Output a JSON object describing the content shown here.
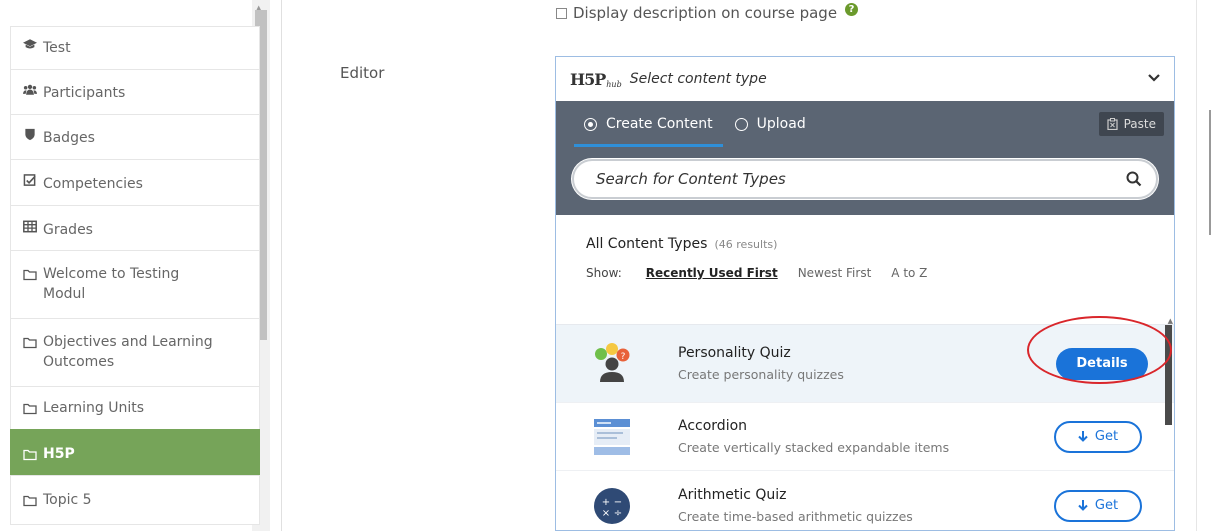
{
  "sidebar": {
    "items": [
      {
        "label": "Test",
        "icon": "graduation-cap-icon"
      },
      {
        "label": "Participants",
        "icon": "users-icon"
      },
      {
        "label": "Badges",
        "icon": "shield-icon"
      },
      {
        "label": "Competencies",
        "icon": "check-square-icon"
      },
      {
        "label": "Grades",
        "icon": "table-icon"
      },
      {
        "label": "Welcome to Testing Modul",
        "icon": "folder-icon"
      },
      {
        "label": "Objectives and Learning Outcomes",
        "icon": "folder-icon"
      },
      {
        "label": "Learning Units",
        "icon": "folder-icon"
      },
      {
        "label": "H5P",
        "icon": "folder-icon",
        "active": true
      },
      {
        "label": "Topic 5",
        "icon": "folder-icon"
      }
    ],
    "active_color": "#76a459"
  },
  "form": {
    "display_description_label": "Display description on course page",
    "editor_label": "Editor"
  },
  "hub": {
    "logo": "H5P",
    "logo_sub": "hub",
    "title": "Select content type",
    "tabs": {
      "create": "Create Content",
      "upload": "Upload",
      "paste": "Paste"
    },
    "search_placeholder": "Search for Content Types",
    "results_title": "All Content Types",
    "results_count": "(46 results)",
    "show_label": "Show:",
    "sort": {
      "recent": "Recently Used First",
      "newest": "Newest First",
      "atoz": "A to Z"
    },
    "items": [
      {
        "name": "Personality Quiz",
        "desc": "Create personality quizzes",
        "button": "Details",
        "icon": "personality-quiz-icon"
      },
      {
        "name": "Accordion",
        "desc": "Create vertically stacked expandable items",
        "button": "Get",
        "icon": "accordion-icon"
      },
      {
        "name": "Arithmetic Quiz",
        "desc": "Create time-based arithmetic quizzes",
        "button": "Get",
        "icon": "arithmetic-quiz-icon"
      }
    ],
    "accent_color": "#1a73d9",
    "band_color": "#5b6573"
  }
}
